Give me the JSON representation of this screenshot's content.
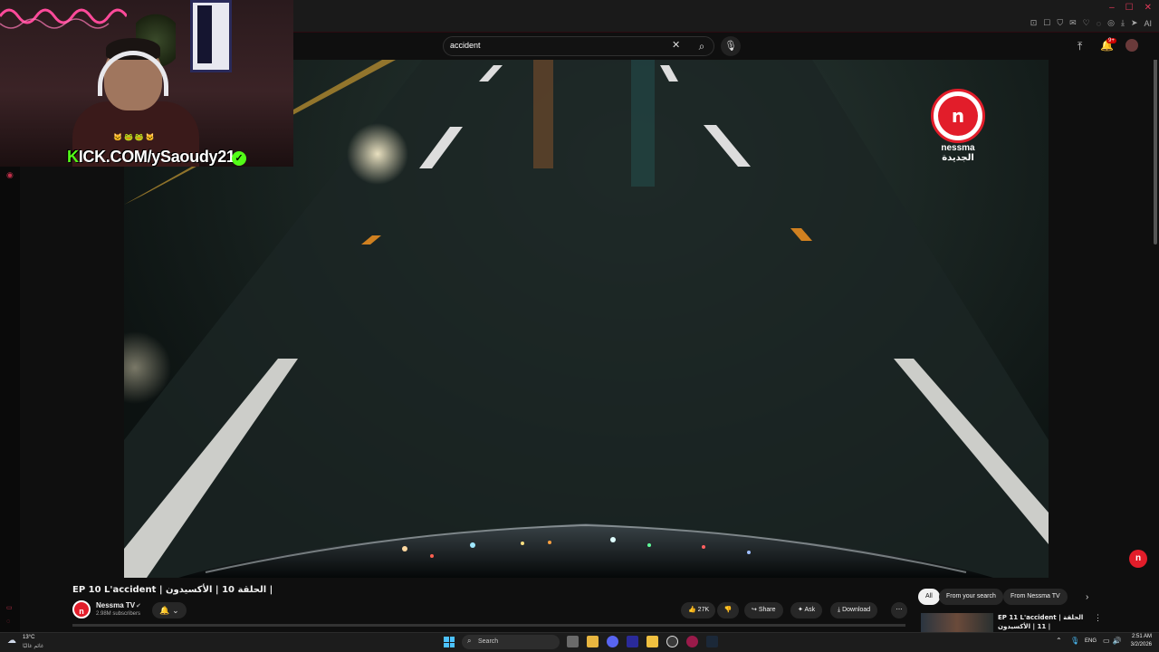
{
  "search": {
    "query": "accident"
  },
  "header": {
    "notification_count": "9+",
    "ai_label": "AI"
  },
  "overlay": {
    "kick_prefix": "K",
    "kick_text": "ICK.COM/ySaoudy21",
    "emotes": "🐱🐸🐸🐱"
  },
  "video": {
    "title": "EP 10 L'accident | الحلقة 10 | الأكسيدون |",
    "logo_name": "nessma",
    "logo_name_ar": "الجديدة",
    "logo_glyph": "n"
  },
  "channel": {
    "name": "Nessma TV",
    "subscribers": "2.98M subscribers",
    "verified": "✔"
  },
  "actions": {
    "like_count": "27K",
    "share": "Share",
    "ask": "Ask",
    "download": "Download",
    "more": "⋯"
  },
  "chips": [
    "All",
    "From your search",
    "From Nessma TV"
  ],
  "recommendation": {
    "title": "EP 11 L'accident | الحلقة 11 | الأكسيدون |"
  },
  "taskbar": {
    "weather_temp": "13°C",
    "weather_desc": "غائم غالبًا",
    "search_label": "Search",
    "lang": "ENG",
    "time": "2:51 AM",
    "date": "3/2/2026"
  },
  "colors": {
    "brand_red": "#e21d2a",
    "kick_green": "#53fc18",
    "accent_pink": "#c0304a"
  }
}
